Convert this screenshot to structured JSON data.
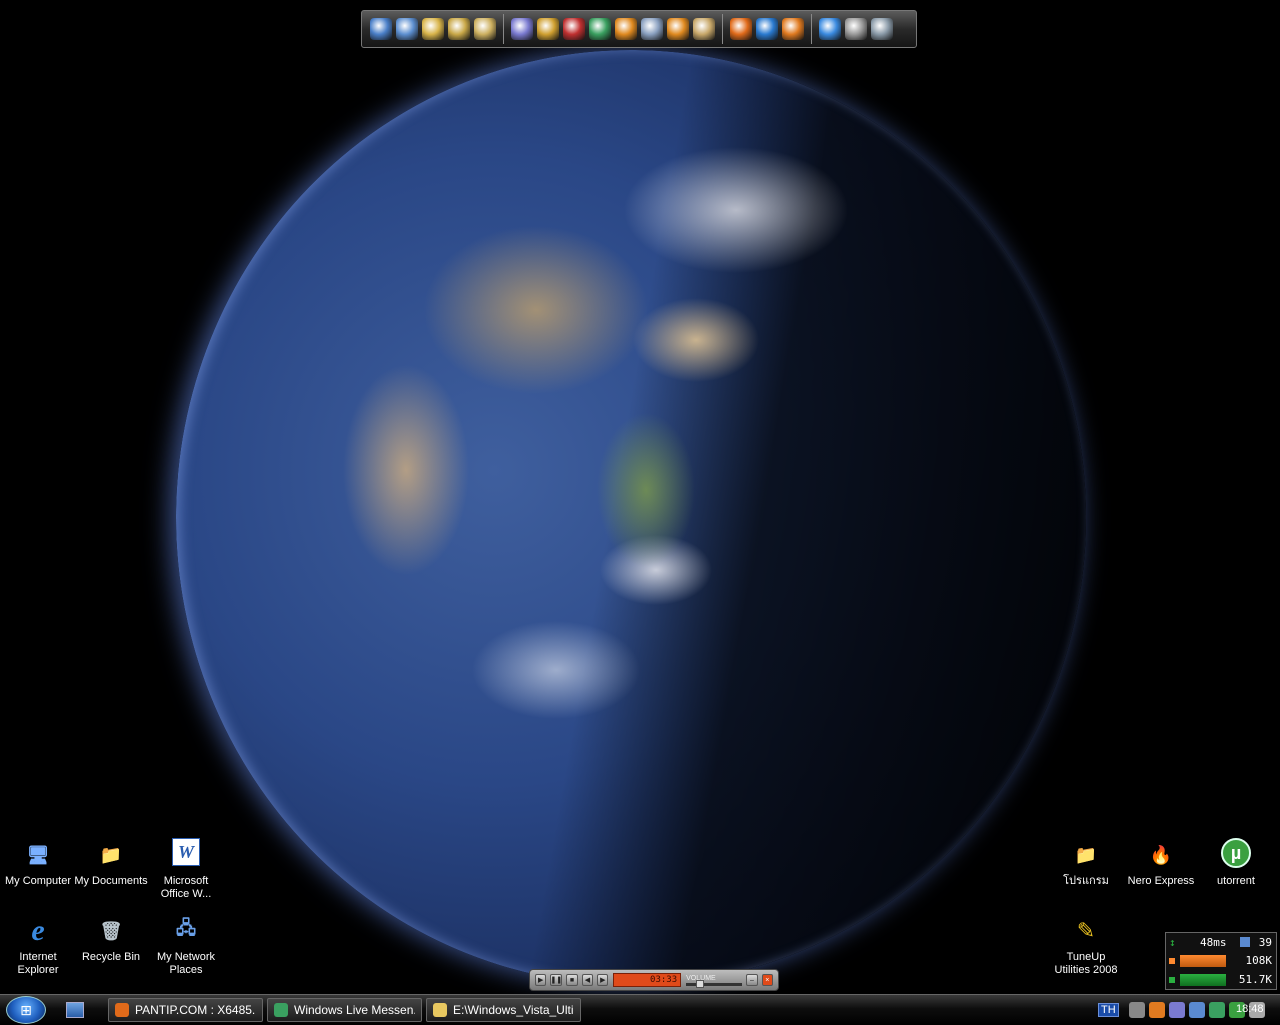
{
  "dock": {
    "groups": [
      [
        {
          "name": "monitor-icon",
          "color": "#4a7fc8"
        },
        {
          "name": "shortcut-window-icon",
          "color": "#5d8fd0"
        },
        {
          "name": "folder-icon",
          "color": "#d8b44a"
        },
        {
          "name": "folder-doc-icon",
          "color": "#c9a848"
        },
        {
          "name": "folder-page-icon",
          "color": "#cdb060"
        }
      ],
      [
        {
          "name": "globe-app-icon",
          "color": "#7a7ad0"
        },
        {
          "name": "cd-icon",
          "color": "#d0a030"
        },
        {
          "name": "disc-burn-icon",
          "color": "#c03030"
        },
        {
          "name": "messenger-icon",
          "color": "#3aa060"
        },
        {
          "name": "aimp-icon",
          "color": "#e08a20"
        },
        {
          "name": "magnifier-icon",
          "color": "#8aa0c0"
        },
        {
          "name": "aimp2-icon",
          "color": "#e08a20"
        },
        {
          "name": "house-online-icon",
          "color": "#c8a86a"
        }
      ],
      [
        {
          "name": "firefox-icon",
          "color": "#e06a1a"
        },
        {
          "name": "network-globe-icon",
          "color": "#2a7ad0"
        },
        {
          "name": "media-player-icon",
          "color": "#e07a20"
        }
      ],
      [
        {
          "name": "windows-icon",
          "color": "#3a8ae0"
        },
        {
          "name": "gear-icon",
          "color": "#9a9a9a"
        },
        {
          "name": "trash-icon",
          "color": "#8a9aa8"
        }
      ]
    ]
  },
  "desktop_icons_left": [
    {
      "id": "my-computer",
      "label": "My Computer",
      "glyph": "🖥",
      "color": "#7ab0ff"
    },
    {
      "id": "my-documents",
      "label": "My Documents",
      "glyph": "📁",
      "color": "#e8c860"
    },
    {
      "id": "microsoft-office-word",
      "label": "Microsoft Office W...",
      "glyph": "W",
      "color": "#2a5db0"
    },
    {
      "id": "internet-explorer",
      "label": "Internet Explorer",
      "glyph": "e",
      "color": "#3a8ae0"
    },
    {
      "id": "recycle-bin",
      "label": "Recycle Bin",
      "glyph": "🗑",
      "color": "#b8c4cc"
    },
    {
      "id": "my-network-places",
      "label": "My Network Places",
      "glyph": "🖧",
      "color": "#6aa0e8"
    }
  ],
  "desktop_icons_right": [
    {
      "id": "programs-folder",
      "label": "โปรแกรม",
      "glyph": "📁",
      "color": "#e8c860"
    },
    {
      "id": "nero-express",
      "label": "Nero Express",
      "glyph": "🔥",
      "color": "#d05a30"
    },
    {
      "id": "utorrent",
      "label": "utorrent",
      "glyph": "µ",
      "color": "#3aa040"
    },
    {
      "id": "tuneup-utilities",
      "label": "TuneUp Utilities 2008",
      "glyph": "✎",
      "color": "#e8c020"
    }
  ],
  "player": {
    "time": "03:33",
    "volume_label": "VOLUME"
  },
  "netmeter": {
    "ping": "48ms",
    "count": "39",
    "upload": "108K",
    "download": "51.7K",
    "upload_color": "#ff8a30",
    "download_color": "#2ab040"
  },
  "taskbar": {
    "tasks": [
      {
        "label": "PANTIP.COM : X6485...",
        "icon_color": "#e06a1a",
        "icon": "firefox-icon"
      },
      {
        "label": "Windows Live Messen...",
        "icon_color": "#3aa060",
        "icon": "messenger-icon"
      },
      {
        "label": "E:\\Windows_Vista_Ulti...",
        "icon_color": "#e8c860",
        "icon": "folder-icon"
      }
    ],
    "language": "TH",
    "tray_icons": [
      {
        "name": "chevron-left-icon",
        "color": "#888888"
      },
      {
        "name": "media-player-tray-icon",
        "color": "#e07a20"
      },
      {
        "name": "globe-tray-icon",
        "color": "#7a7ad0"
      },
      {
        "name": "network-tray-icon",
        "color": "#5a8ad0"
      },
      {
        "name": "messenger-tray-icon",
        "color": "#3aa060"
      },
      {
        "name": "utorrent-tray-icon",
        "color": "#3aa040"
      },
      {
        "name": "battery-tray-icon",
        "color": "#aaaaaa"
      }
    ],
    "clock": "18:48"
  }
}
